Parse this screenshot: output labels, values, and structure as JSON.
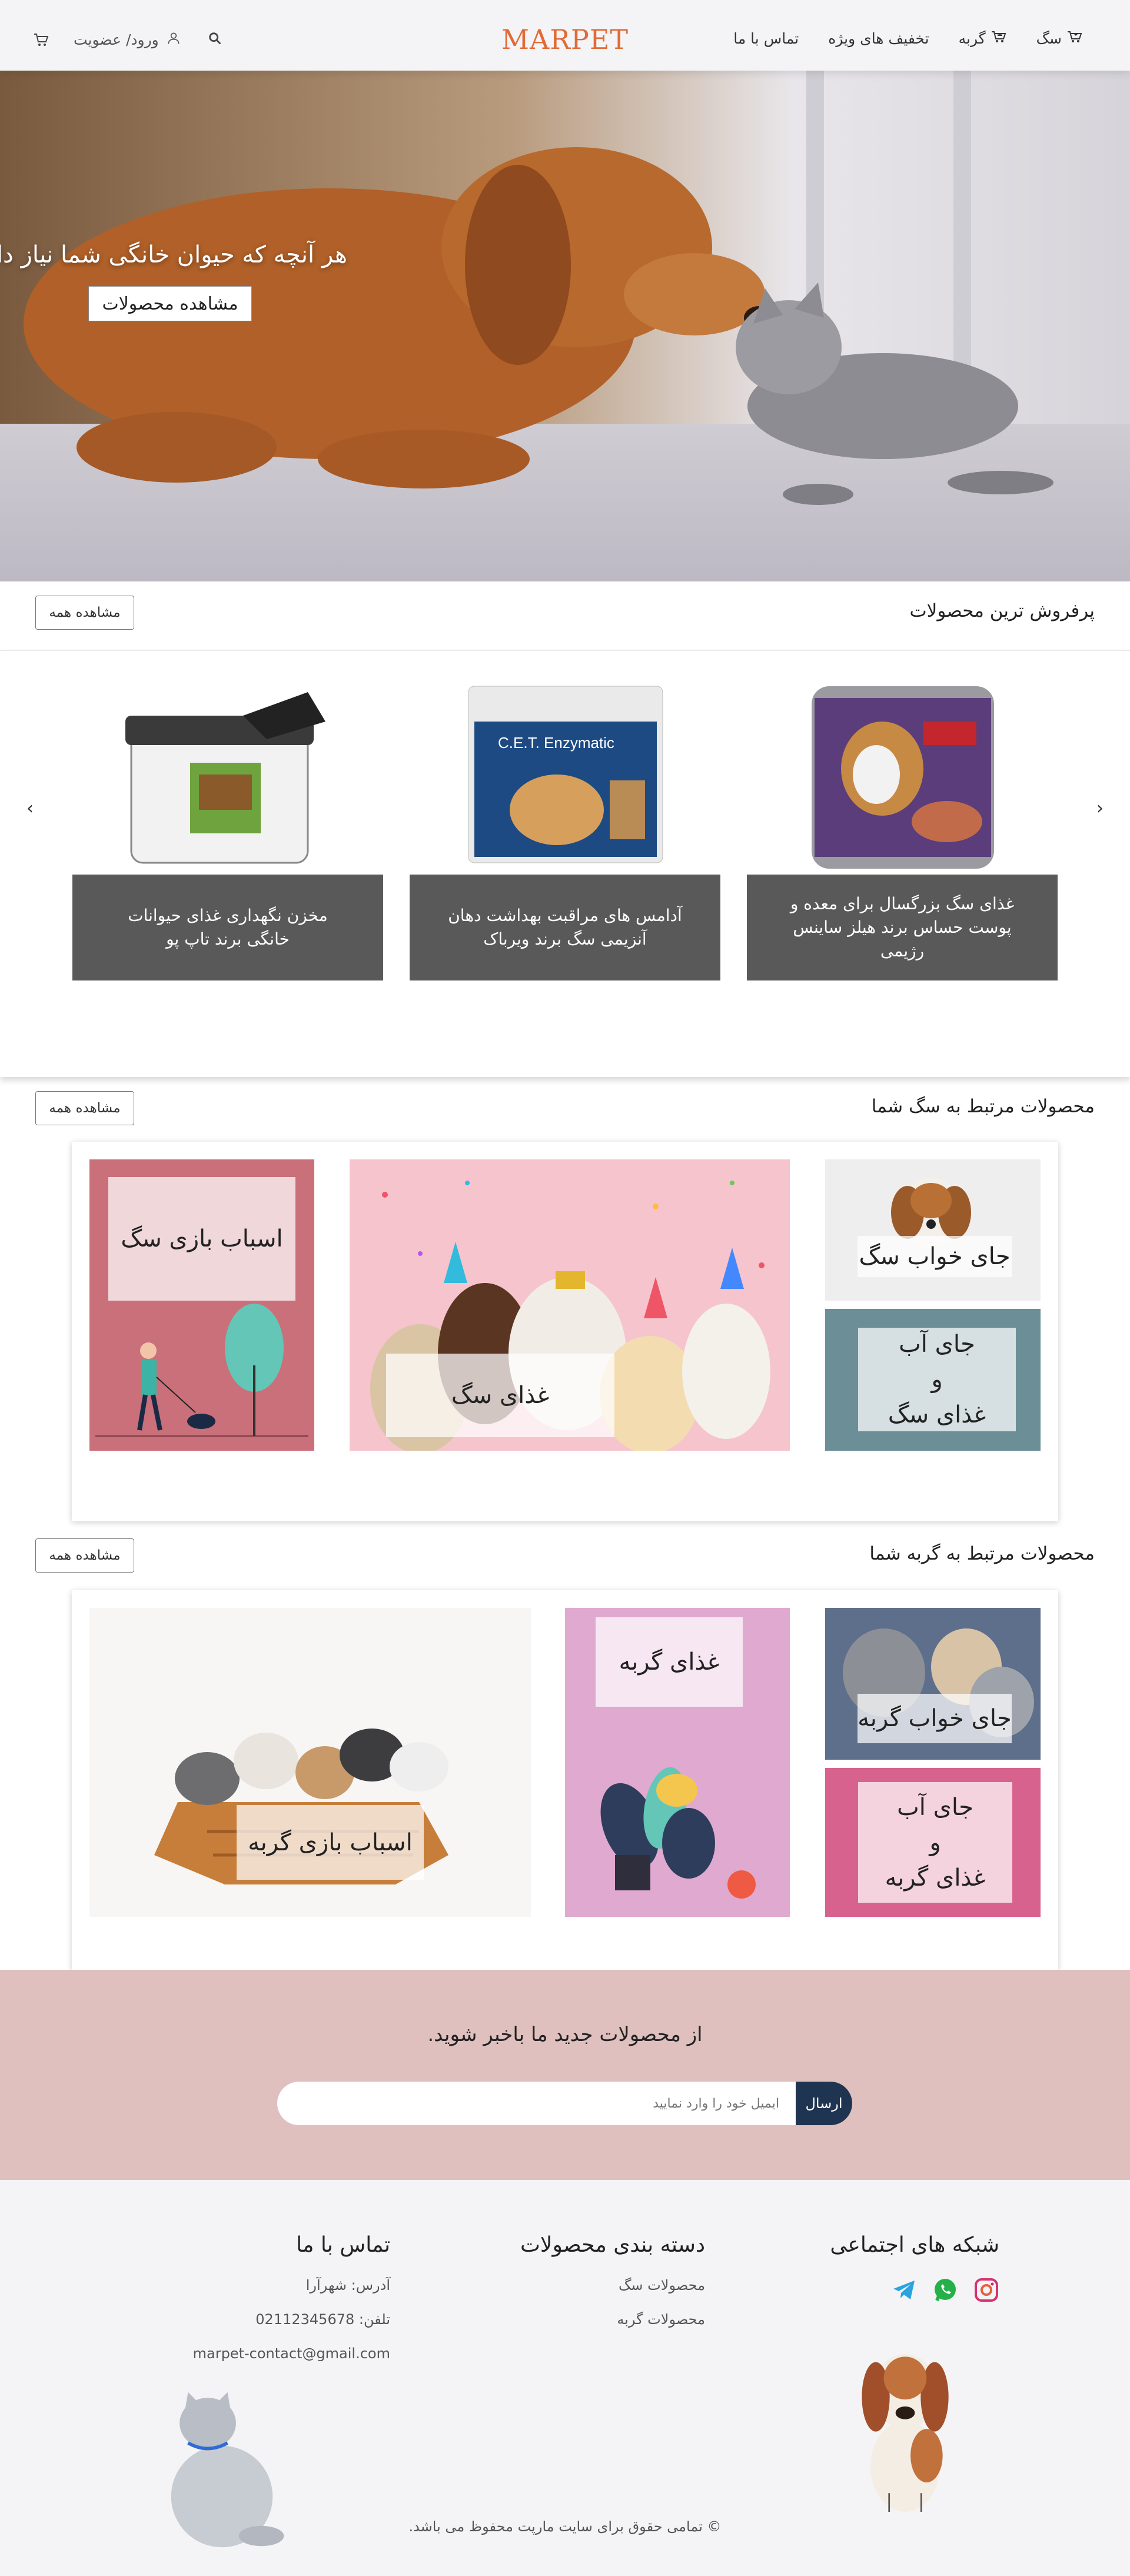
{
  "header": {
    "logo": "MARPET",
    "nav": [
      {
        "label": "سگ",
        "icon": "dog-cart-icon"
      },
      {
        "label": "گربه",
        "icon": "cat-cart-icon"
      },
      {
        "label": "تخفیف های ویژه"
      },
      {
        "label": "تماس با ما"
      }
    ],
    "login_label": "ورود/ عضویت",
    "icons": [
      "cart-icon",
      "user-icon",
      "search-icon"
    ]
  },
  "hero": {
    "title": "هر آنچه که حیوان خانگی شما نیاز دارد",
    "button": "مشاهده محصولات"
  },
  "best_sellers": {
    "title": "پرفروش ترین محصولات",
    "see_all": "مشاهده همه",
    "products": [
      {
        "name": "غذای سگ بزرگسال برای معده و پوست حساس برند هیلز ساینس رژیمی"
      },
      {
        "name": "آدامس های مراقبت بهداشت دهان آنزیمی سگ برند ویرباک"
      },
      {
        "name": "مخزن نگهداری غذای حیوانات خانگی برند تاپ پو"
      }
    ]
  },
  "dog_section": {
    "title": "محصولات مرتبط به سگ شما",
    "see_all": "مشاهده همه",
    "tiles": {
      "bed": "جای خواب سگ",
      "water": "جای آب\nو\nغذای سگ",
      "food": "غذای سگ",
      "toys": "اسباب بازی سگ"
    }
  },
  "cat_section": {
    "title": "محصولات مرتبط به گربه شما",
    "see_all": "مشاهده همه",
    "tiles": {
      "bed": "جای خواب گربه",
      "water": "جای آب\nو\nغذای گربه",
      "food": "غذای گربه",
      "toys": "اسباب بازی گربه"
    }
  },
  "newsletter": {
    "title": "از محصولات جدید ما باخبر شوید.",
    "placeholder": "ایمیل خود را وارد نمایید",
    "button": "ارسال"
  },
  "footer": {
    "social": {
      "title": "شبکه های اجتماعی",
      "icons": [
        "instagram-icon",
        "whatsapp-icon",
        "telegram-icon"
      ]
    },
    "categories": {
      "title": "دسته بندی محصولات",
      "items": [
        "محصولات سگ",
        "محصولات گربه"
      ]
    },
    "contact": {
      "title": "تماس با ما",
      "address": "آدرس: شهرآرا",
      "phone": "تلفن: 02112345678",
      "email": "marpet-contact@gmail.com"
    },
    "copyright": "© تمامی حقوق برای سایت مارپت محفوظ می باشد."
  },
  "colors": {
    "logo": "#e26a36",
    "newsletter_bg": "#dfc0bf",
    "send_button": "#1f3450",
    "caption_bg": "#595959"
  }
}
